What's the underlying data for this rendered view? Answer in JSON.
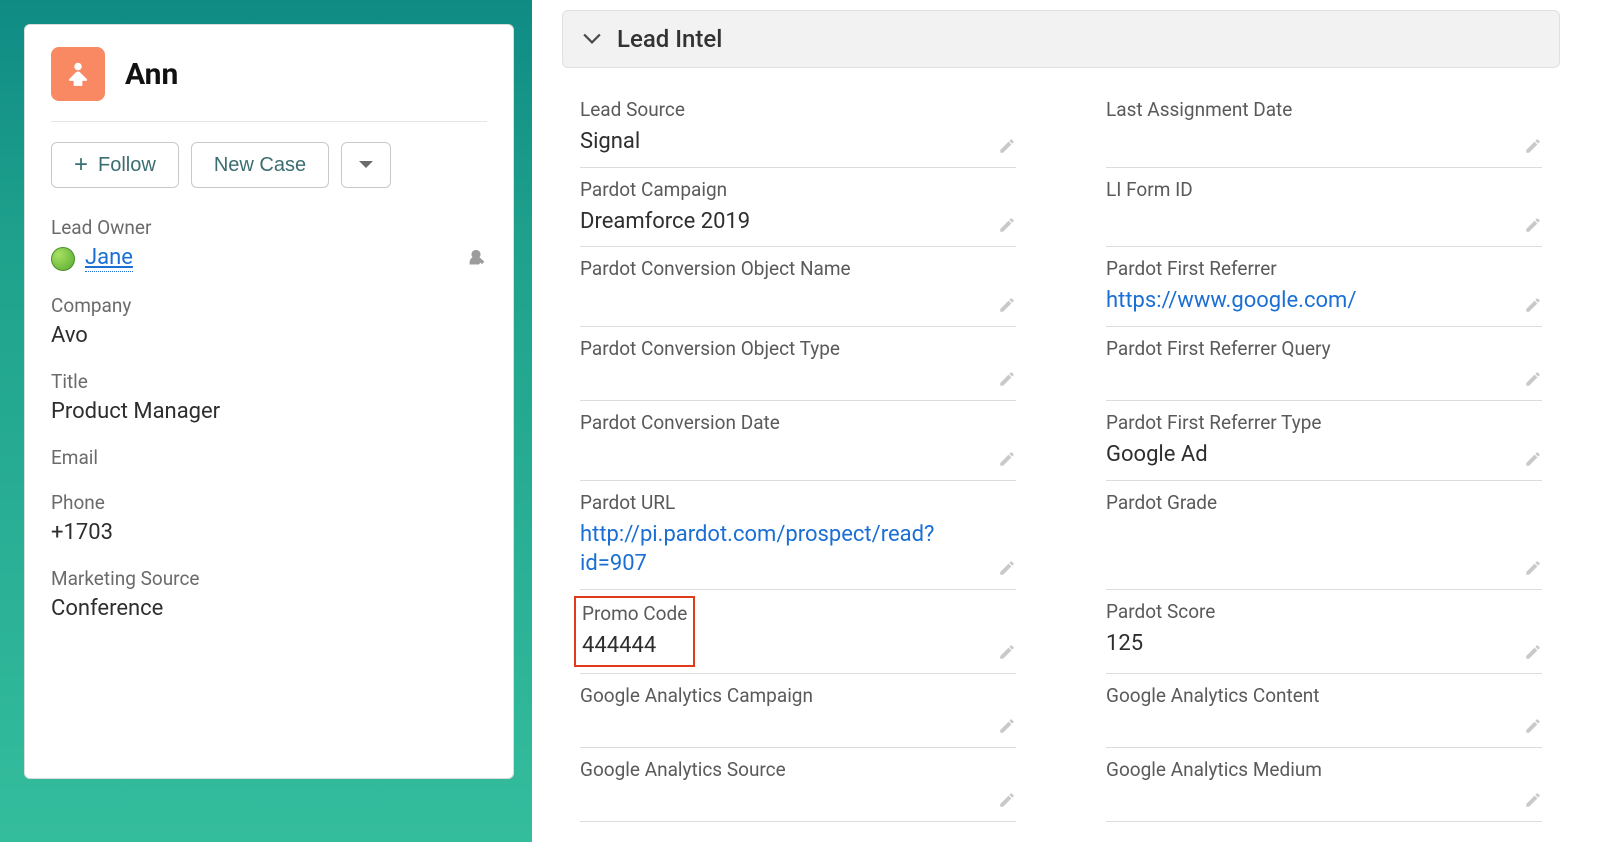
{
  "lead": {
    "name": "Ann",
    "owner_label": "Lead Owner",
    "owner_name": "Jane",
    "company_label": "Company",
    "company": "Avo",
    "title_label": "Title",
    "title": "Product Manager",
    "email_label": "Email",
    "email": "",
    "phone_label": "Phone",
    "phone": "+1703",
    "mkt_src_label": "Marketing Source",
    "mkt_src": "Conference"
  },
  "actions": {
    "follow": "Follow",
    "new_case": "New Case"
  },
  "section": {
    "title": "Lead Intel"
  },
  "fields_left": [
    {
      "label": "Lead Source",
      "value": "Signal",
      "link": false
    },
    {
      "label": "Pardot Campaign",
      "value": "Dreamforce 2019",
      "link": false
    },
    {
      "label": "Pardot Conversion Object Name",
      "value": "",
      "link": false
    },
    {
      "label": "Pardot Conversion Object Type",
      "value": "",
      "link": false
    },
    {
      "label": "Pardot Conversion Date",
      "value": "",
      "link": false
    },
    {
      "label": "Pardot URL",
      "value": "http://pi.pardot.com/prospect/read?id=907",
      "link": true
    },
    {
      "label": "Promo Code",
      "value": "444444",
      "link": false,
      "highlight": true
    },
    {
      "label": "Google Analytics Campaign",
      "value": "",
      "link": false
    },
    {
      "label": "Google Analytics Source",
      "value": "",
      "link": false
    }
  ],
  "fields_right": [
    {
      "label": "Last Assignment Date",
      "value": "",
      "link": false
    },
    {
      "label": "LI Form ID",
      "value": "",
      "link": false
    },
    {
      "label": "Pardot First Referrer",
      "value": "https://www.google.com/",
      "link": true
    },
    {
      "label": "Pardot First Referrer Query",
      "value": "",
      "link": false
    },
    {
      "label": "Pardot First Referrer Type",
      "value": "Google Ad",
      "link": false
    },
    {
      "label": "Pardot Grade",
      "value": "",
      "link": false
    },
    {
      "label": "Pardot Score",
      "value": "125",
      "link": false
    },
    {
      "label": "Google Analytics Content",
      "value": "",
      "link": false
    },
    {
      "label": "Google Analytics Medium",
      "value": "",
      "link": false
    }
  ]
}
